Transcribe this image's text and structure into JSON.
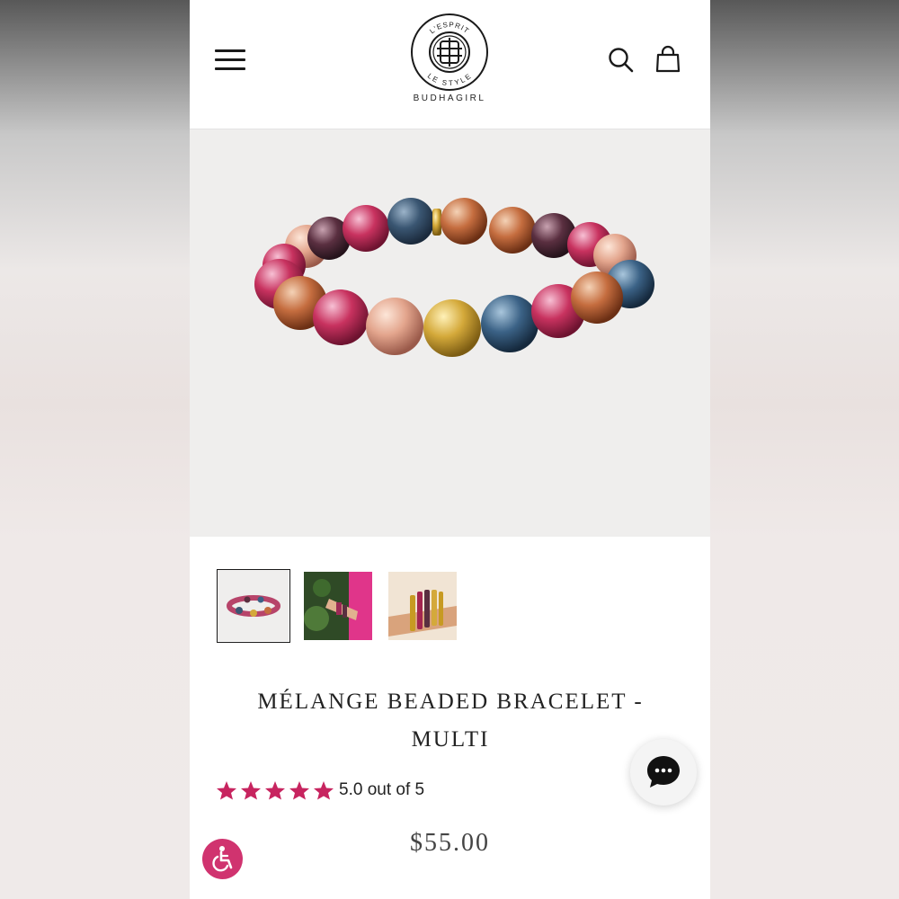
{
  "header": {
    "logo": {
      "ring_top": "L'ESPRIT",
      "ring_bottom": "LE STYLE",
      "brand": "BUDHAGIRL"
    },
    "menu_icon": "hamburger-menu-icon",
    "search_icon": "search-icon",
    "cart_icon": "shopping-bag-icon"
  },
  "product": {
    "hero_image": "multicolor faceted beaded bracelet with gold bead",
    "thumbnails": [
      {
        "label": "bracelet-product-shot",
        "selected": true
      },
      {
        "label": "bracelet-on-wrist-pink-sleeve",
        "selected": false
      },
      {
        "label": "bracelet-stacked-with-bangles",
        "selected": false
      }
    ],
    "title": "MÉLANGE BEADED BRACELET - MULTI",
    "rating": {
      "stars": 5,
      "text": "5.0 out of 5"
    },
    "price": "$55.00"
  },
  "widgets": {
    "chat_icon": "chat-bubble-icon",
    "accessibility_icon": "wheelchair-accessibility-icon"
  },
  "colors": {
    "accent_pink": "#d0336f",
    "star_pink": "#c7245f",
    "text_dark": "#222222",
    "hero_bg": "#efeeed"
  }
}
